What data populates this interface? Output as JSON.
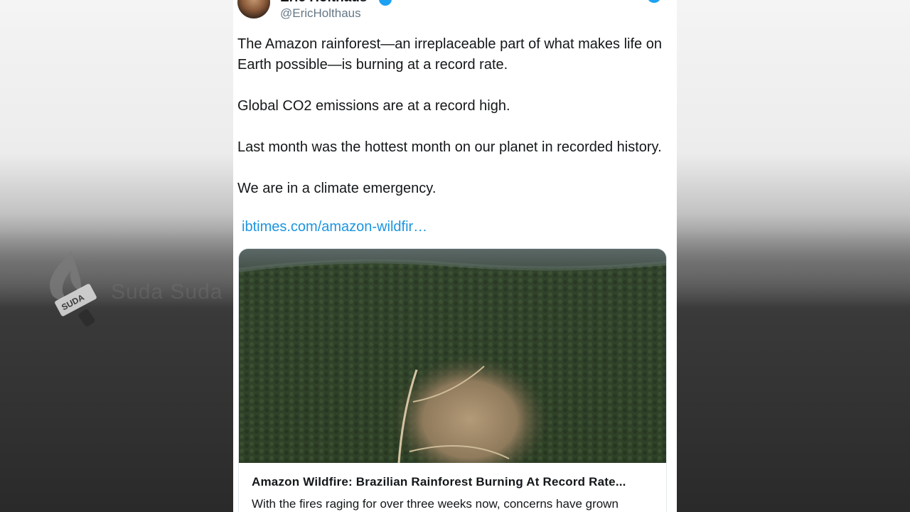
{
  "tweet": {
    "display_name": "Eric Holthaus",
    "handle": "@EricHolthaus",
    "paragraphs": [
      "The Amazon rainforest—an irreplaceable part of what makes life on Earth possible—is burning at a record rate.",
      "Global CO2 emissions are at a record high.",
      "Last month was the hottest month on our planet in recorded history.",
      "We are in a climate emergency."
    ],
    "link": "ibtimes.com/amazon-wildfir…",
    "card": {
      "title": "Amazon Wildfire: Brazilian Rainforest Burning At Record Rate...",
      "description": "With the fires raging for over three weeks now, concerns have grown"
    }
  },
  "watermark": {
    "badge_text": "SUDA",
    "text": "Suda Suda"
  },
  "colors": {
    "link": "#1b95e0",
    "verified": "#1da1f2",
    "handle": "#657786"
  }
}
